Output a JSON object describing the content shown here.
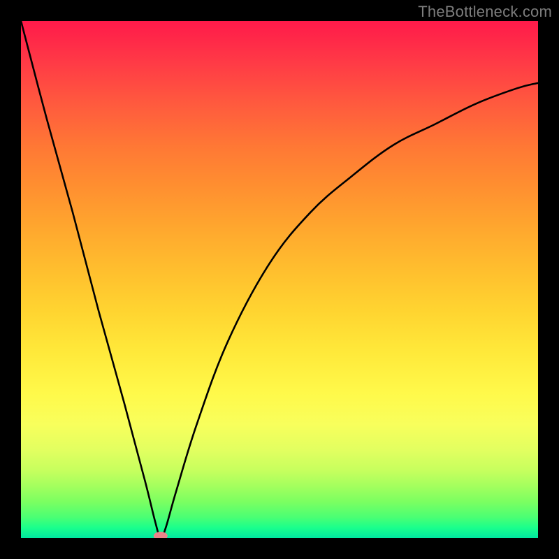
{
  "watermark": "TheBottleneck.com",
  "chart_data": {
    "type": "line",
    "title": "",
    "xlabel": "",
    "ylabel": "",
    "xlim": [
      0,
      100
    ],
    "ylim": [
      0,
      100
    ],
    "min_point": {
      "x": 27,
      "y": 0
    },
    "marker": {
      "x": 27,
      "y": 0,
      "color": "#e9848a"
    },
    "series": [
      {
        "name": "bottleneck-curve",
        "x": [
          0,
          5,
          10,
          15,
          20,
          24,
          26,
          27,
          28,
          30,
          34,
          40,
          48,
          56,
          64,
          72,
          80,
          88,
          96,
          100
        ],
        "values": [
          100,
          81,
          63,
          44,
          26,
          11,
          3,
          0,
          2,
          9,
          22,
          38,
          53,
          63,
          70,
          76,
          80,
          84,
          87,
          88
        ]
      }
    ],
    "gradient_stops": [
      {
        "pos": 0,
        "color": "#ff1a4a"
      },
      {
        "pos": 50,
        "color": "#ffd430"
      },
      {
        "pos": 80,
        "color": "#e2ff60"
      },
      {
        "pos": 100,
        "color": "#00e8a0"
      }
    ]
  }
}
